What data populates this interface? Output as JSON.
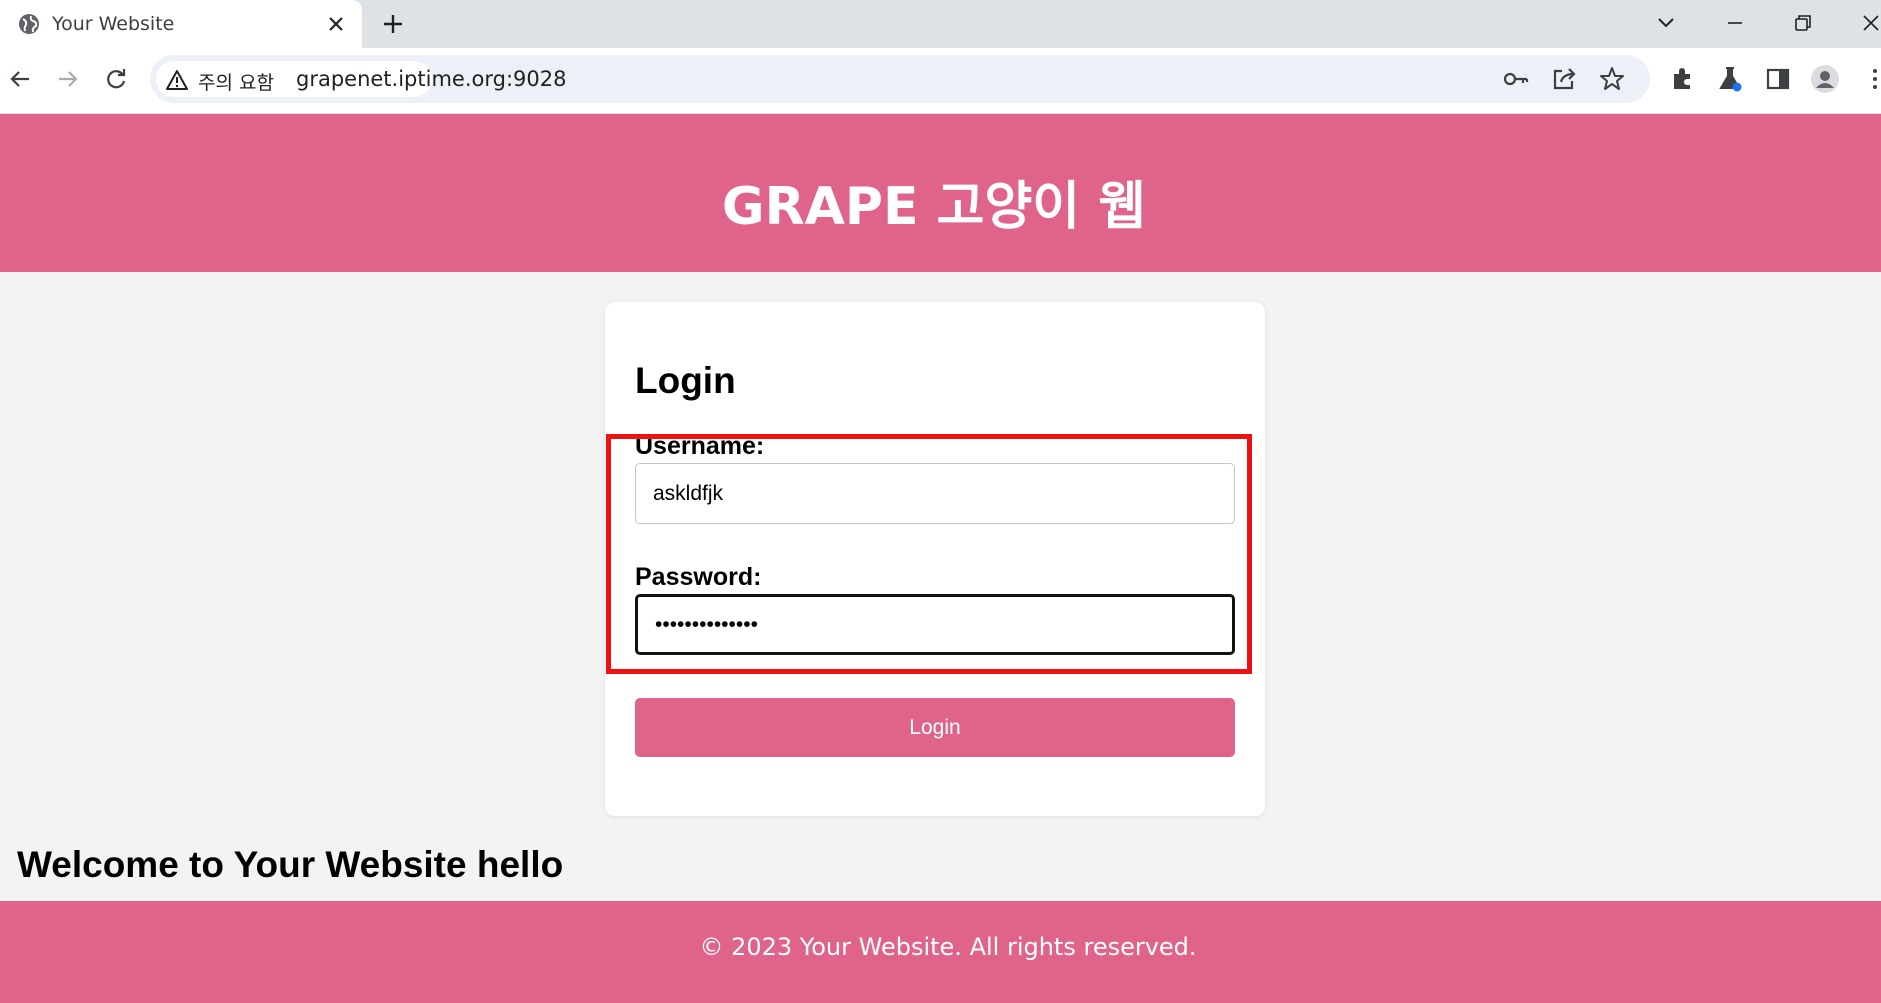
{
  "browser": {
    "tab_title": "Your Website",
    "security_label": "주의 요함",
    "url": "grapenet.iptime.org:9028"
  },
  "page": {
    "site_title": "GRAPE 고양이 웹",
    "login": {
      "title": "Login",
      "username_label": "Username:",
      "username_value": "askldfjk",
      "password_label": "Password:",
      "password_value": "aaaaaaaaaaaaaa",
      "submit_label": "Login"
    },
    "welcome_text": "Welcome to Your Website hello",
    "footer_text": "© 2023 Your Website. All rights reserved."
  },
  "colors": {
    "brand": "#e06389",
    "highlight": "#ee1111"
  },
  "icons": [
    "globe-icon",
    "close-icon",
    "plus-icon",
    "chevron-down-icon",
    "minimize-icon",
    "restore-icon",
    "back-icon",
    "forward-icon",
    "reload-icon",
    "warning-icon",
    "key-icon",
    "share-icon",
    "star-icon",
    "extensions-icon",
    "labs-icon",
    "side-panel-icon",
    "profile-icon",
    "menu-icon"
  ]
}
